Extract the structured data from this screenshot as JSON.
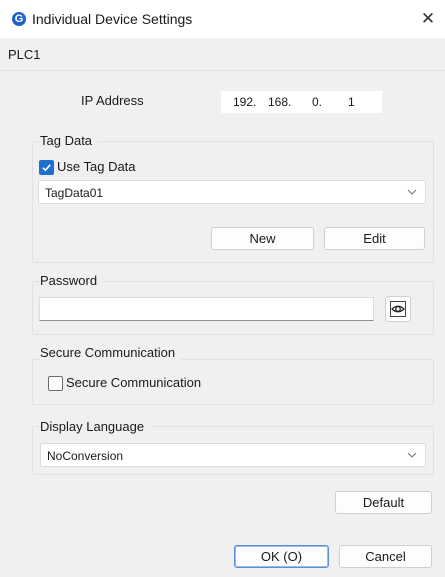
{
  "window": {
    "title": "Individual Device Settings",
    "app_icon": "app-logo-icon",
    "close_icon": "close-icon",
    "close_glyph": "✕"
  },
  "device": {
    "name": "PLC1"
  },
  "ip": {
    "label": "IP Address",
    "octets": [
      "192.",
      "168.",
      "0.",
      "1"
    ]
  },
  "tag_data": {
    "group_title": "Tag Data",
    "checkbox_label": "Use Tag Data",
    "checked": true,
    "selected": "TagData01",
    "new_label": "New",
    "edit_label": "Edit"
  },
  "password": {
    "group_title": "Password",
    "value": "",
    "reveal_icon": "eye-icon"
  },
  "secure": {
    "group_title": "Secure Communication",
    "checkbox_label": "Secure Communication",
    "checked": false
  },
  "language": {
    "group_title": "Display Language",
    "selected": "NoConversion"
  },
  "footer": {
    "default_label": "Default",
    "ok_label": "OK (O)",
    "cancel_label": "Cancel"
  },
  "colors": {
    "accent": "#1f6fd1",
    "background": "#f0f0f0",
    "titlebar": "#ffffff"
  }
}
